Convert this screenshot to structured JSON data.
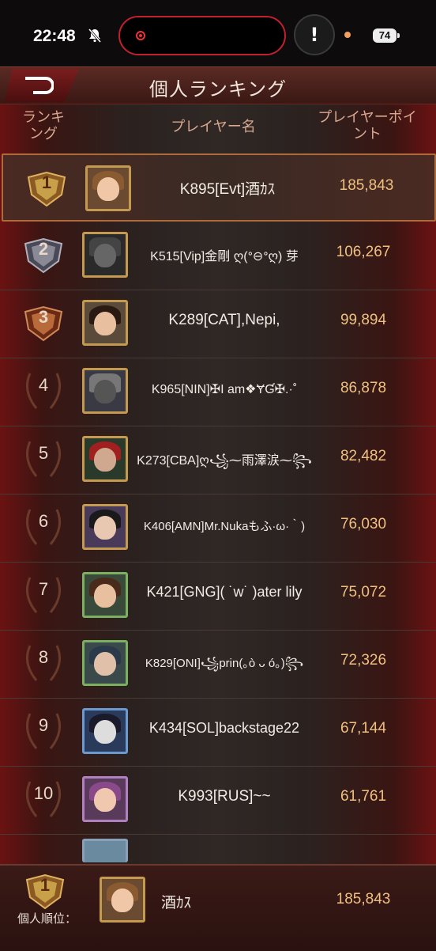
{
  "status": {
    "time": "22:48",
    "battery": "74"
  },
  "header": {
    "title": "個人ランキング"
  },
  "columns": {
    "rank": "ランキング",
    "name": "プレイヤー名",
    "points": "プレイヤーポイント"
  },
  "colors": {
    "gold": "#c9a04a",
    "silver": "#8a8a96",
    "bronze": "#b86a3a",
    "points": "#f0c080",
    "highlight_border": "#b06a3a"
  },
  "rows": [
    {
      "rank": "1",
      "name": "K895[Evt]酒ｶｽ",
      "points": "185,843",
      "avatar": "bear-hood-girl-avatar"
    },
    {
      "rank": "2",
      "name": "K515[Vip]金剛 ღ(ᐤ⊖ᐤღ) 芽",
      "points": "106,267",
      "avatar": "panther-warrior-avatar"
    },
    {
      "rank": "3",
      "name": "K289[CAT],Nepi,",
      "points": "99,894",
      "avatar": "dark-hair-lady-avatar"
    },
    {
      "rank": "4",
      "name": "K965[NIN]✠I am❖ɎƓ✠.·˚",
      "points": "86,878",
      "avatar": "armored-knight-avatar"
    },
    {
      "rank": "5",
      "name": "K273[CBA]ღ꧁⁓雨澤涙⁓꧂",
      "points": "82,482",
      "avatar": "red-hood-avatar"
    },
    {
      "rank": "6",
      "name": "K406[AMN]Mr.Nukaもふ·ω·｀)",
      "points": "76,030",
      "avatar": "glasses-lady-avatar"
    },
    {
      "rank": "7",
      "name": "K421[GNG]( ˙w˙ )ater lily",
      "points": "75,072",
      "avatar": "brunette-flower-avatar"
    },
    {
      "rank": "8",
      "name": "K829[ONI]꧁prin(｡ò ᴗ ó｡)꧂",
      "points": "72,326",
      "avatar": "blue-hair-flower-avatar"
    },
    {
      "rank": "9",
      "name": "K434[SOL]backstage22",
      "points": "67,144",
      "avatar": "masked-assassin-avatar"
    },
    {
      "rank": "10",
      "name": "K993[RUS]~~",
      "points": "61,761",
      "avatar": "purple-hair-girl-avatar"
    }
  ],
  "footer": {
    "label": "個人順位：",
    "rank": "1",
    "name": "酒ｶｽ",
    "points": "185,843"
  }
}
